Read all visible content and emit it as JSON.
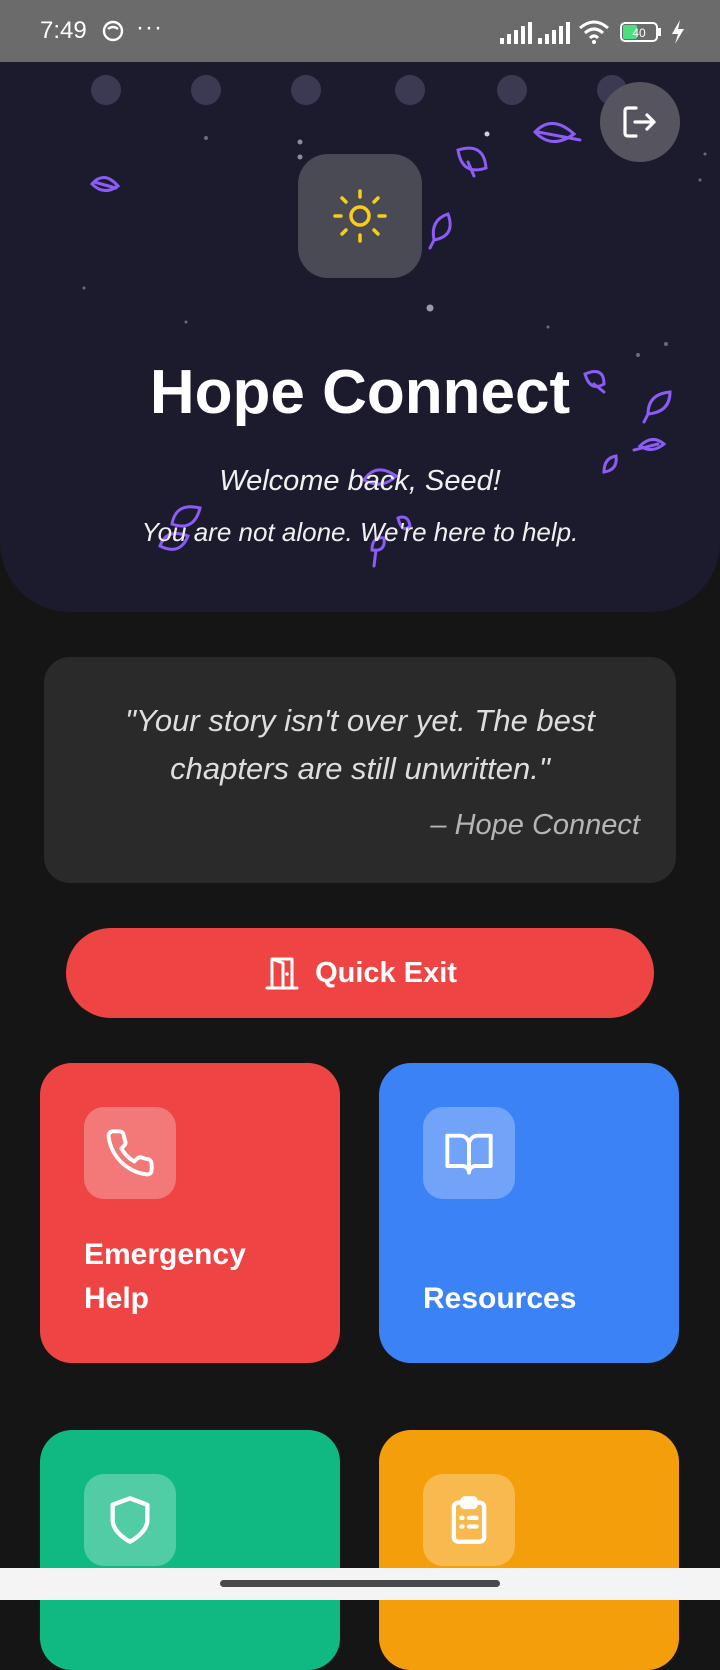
{
  "status_bar": {
    "time": "7:49",
    "battery": "40"
  },
  "header": {
    "title": "Hope Connect",
    "welcome": "Welcome back, Seed!",
    "tagline": "You are not alone. We're here to help."
  },
  "quote": {
    "text": "\"Your story isn't over yet. The best chapters are still unwritten.\"",
    "author": "– Hope Connect"
  },
  "quick_exit": {
    "label": "Quick Exit"
  },
  "tiles": [
    {
      "label": "Emergency Help",
      "icon": "phone-icon",
      "color": "#ef4444"
    },
    {
      "label": "Resources",
      "icon": "book-icon",
      "color": "#3b82f6"
    },
    {
      "label": "",
      "icon": "shield-icon",
      "color": "#10b981"
    },
    {
      "label": "",
      "icon": "clipboard-icon",
      "color": "#f59e0b"
    }
  ],
  "colors": {
    "header_bg": "#1c1b2e",
    "page_bg": "#151515",
    "danger": "#ef4444",
    "sun": "#facc15",
    "leaf": "#8b5cf6"
  }
}
